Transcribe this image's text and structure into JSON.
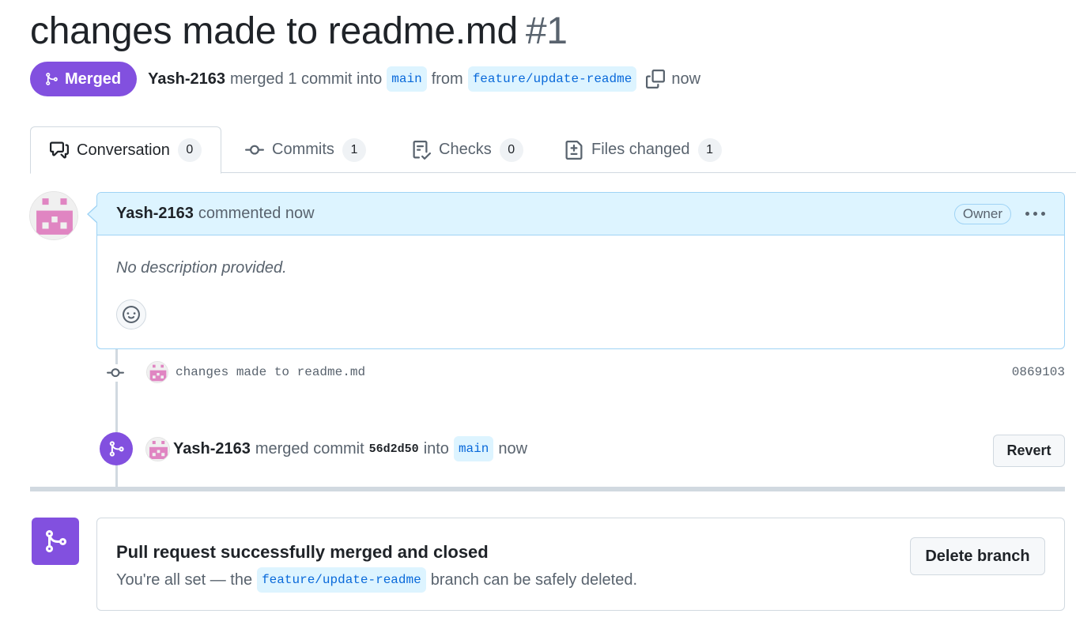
{
  "pr": {
    "title": "changes made to readme.md",
    "number": "#1",
    "status": "Merged",
    "author": "Yash-2163",
    "summary": "merged 1 commit into",
    "base_branch": "main",
    "from_word": "from",
    "head_branch": "feature/update-readme",
    "time": "now"
  },
  "tabs": [
    {
      "label": "Conversation",
      "count": "0",
      "icon": "comment-discussion-icon"
    },
    {
      "label": "Commits",
      "count": "1",
      "icon": "git-commit-icon"
    },
    {
      "label": "Checks",
      "count": "0",
      "icon": "checklist-icon"
    },
    {
      "label": "Files changed",
      "count": "1",
      "icon": "file-diff-icon"
    }
  ],
  "comment": {
    "author": "Yash-2163",
    "action": "commented now",
    "role_badge": "Owner",
    "body": "No description provided."
  },
  "commit": {
    "message": "changes made to readme.md",
    "sha": "0869103"
  },
  "merge_event": {
    "author": "Yash-2163",
    "text_before": "merged commit",
    "sha": "56d2d50",
    "into_word": "into",
    "branch": "main",
    "time": "now",
    "revert_label": "Revert"
  },
  "merged_box": {
    "title": "Pull request successfully merged and closed",
    "desc_before": "You're all set — the",
    "branch": "feature/update-readme",
    "desc_after": "branch can be safely deleted.",
    "delete_label": "Delete branch"
  },
  "colors": {
    "merged_purple": "#8250df",
    "branch_bg": "#ddf4ff",
    "branch_text": "#0969da",
    "avatar_pink": "#e085c2"
  }
}
